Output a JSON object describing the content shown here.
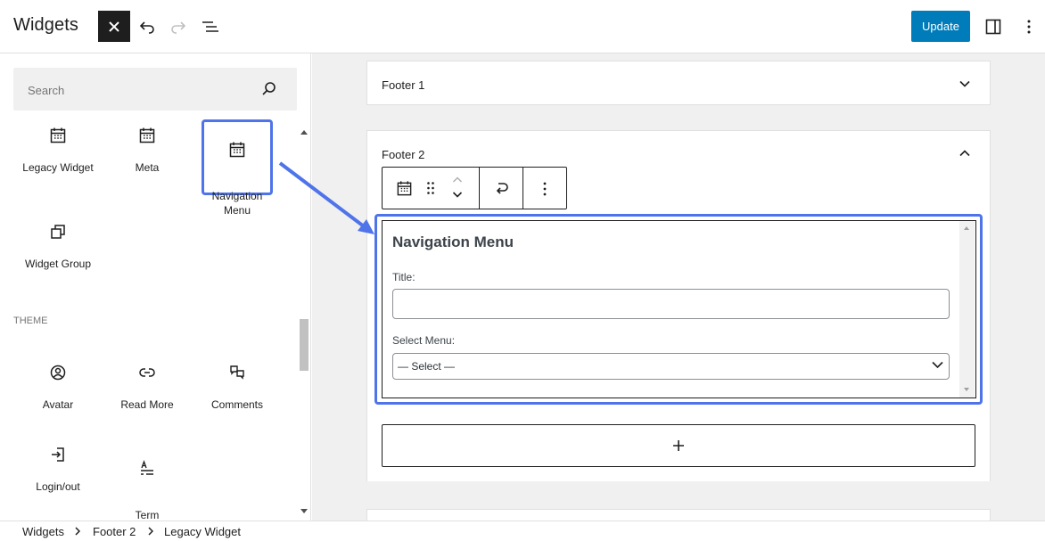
{
  "header": {
    "title": "Widgets",
    "close_icon": "close-icon",
    "undo_icon": "undo-icon",
    "redo_icon": "redo-icon",
    "list_view_icon": "list-view-icon",
    "update_label": "Update",
    "settings_icon": "sidebar-toggle-icon",
    "options_icon": "more-vertical-icon",
    "accent_color": "#007cba"
  },
  "inserter": {
    "search_placeholder": "Search",
    "blocks": [
      {
        "label": "Legacy Widget",
        "icon": "calendar-icon"
      },
      {
        "label": "Meta",
        "icon": "calendar-icon"
      },
      {
        "label": "Navigation\nMenu",
        "icon": "calendar-icon"
      },
      {
        "label": "Widget Group",
        "icon": "group-icon"
      }
    ],
    "theme_section": "THEME",
    "theme_blocks": [
      {
        "label": "Avatar",
        "icon": "avatar-icon"
      },
      {
        "label": "Read More",
        "icon": "link-icon"
      },
      {
        "label": "Comments",
        "icon": "comments-icon"
      },
      {
        "label": "Login/out",
        "icon": "login-icon"
      },
      {
        "label": "Term\nDescription",
        "icon": "term-description-icon"
      }
    ],
    "highlight_color": "#4f74e9"
  },
  "canvas": {
    "footer1_title": "Footer 1",
    "footer2_title": "Footer 2",
    "nav_widget": {
      "heading": "Navigation Menu",
      "title_label": "Title:",
      "title_value": "",
      "menu_label": "Select Menu:",
      "menu_selected": "— Select —"
    },
    "add_block_icon": "plus-icon"
  },
  "breadcrumb": [
    "Widgets",
    "Footer 2",
    "Legacy Widget"
  ]
}
